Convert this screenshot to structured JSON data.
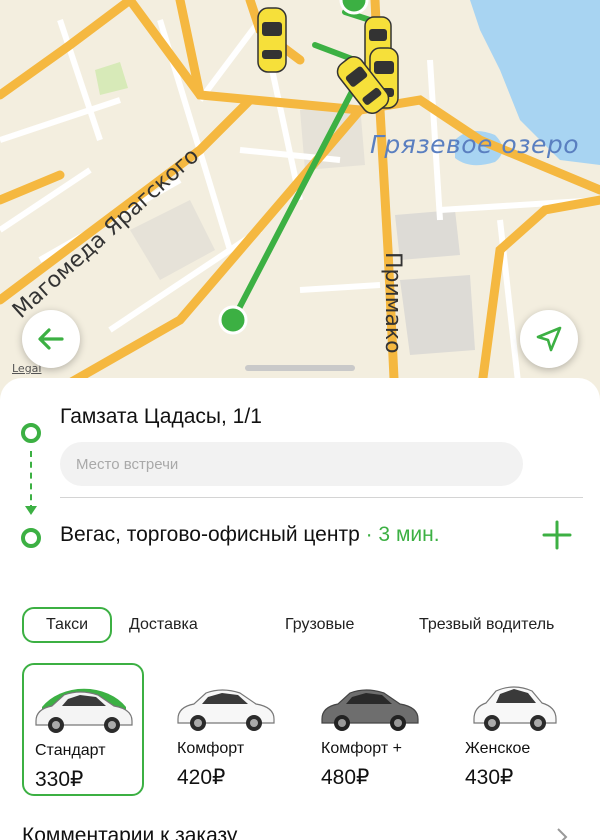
{
  "map": {
    "lake_label": "Грязевое озеро",
    "street_label_1": "Магомеда Ярагского",
    "street_label_2": "Примако",
    "legal_label": "Legal",
    "marker_a": "A",
    "marker_b": "B",
    "route_color": "#3cb043",
    "taxi_color": "#f6e03a"
  },
  "route": {
    "from_address": "Гамзата Цадасы, 1/1",
    "meeting_point_placeholder": "Место встречи",
    "to_address": "Вегас, торгово-офисный центр",
    "to_eta": " · 3 мин."
  },
  "service_tabs": [
    {
      "label": "Такси",
      "active": true
    },
    {
      "label": "Доставка",
      "active": false
    },
    {
      "label": "Грузовые",
      "active": false
    },
    {
      "label": "Трезвый водитель",
      "active": false
    }
  ],
  "tariffs": [
    {
      "name": "Стандарт",
      "price": "330₽",
      "selected": true,
      "car_color": "#f4f4f4"
    },
    {
      "name": "Комфорт",
      "price": "420₽",
      "selected": false,
      "car_color": "#f7f7f7"
    },
    {
      "name": "Комфорт +",
      "price": "480₽",
      "selected": false,
      "car_color": "#6e6e6e"
    },
    {
      "name": "Женское",
      "price": "430₽",
      "selected": false,
      "car_color": "#f8f8f8"
    }
  ],
  "comments": {
    "label": "Комментарии к заказу"
  },
  "accent_color": "#3cb043"
}
